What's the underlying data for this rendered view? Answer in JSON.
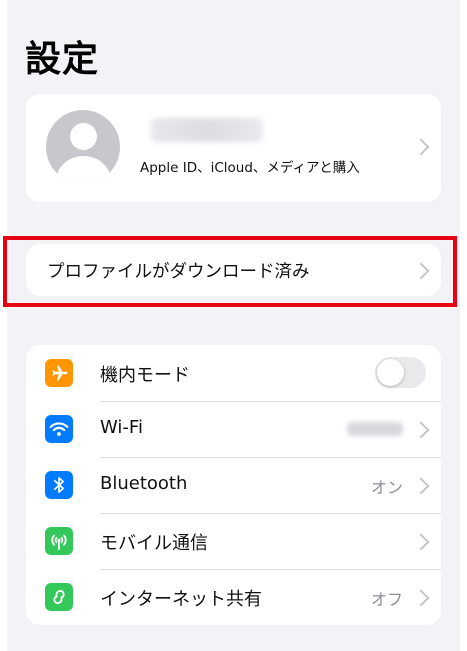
{
  "page": {
    "title": "設定"
  },
  "profile": {
    "subtitle": "Apple ID、iCloud、メディアと購入"
  },
  "downloaded_profile": {
    "label": "プロファイルがダウンロード済み"
  },
  "settings": [
    {
      "label": "機内モード",
      "icon": "airplane-icon",
      "color": "#ff9500"
    },
    {
      "label": "Wi-Fi",
      "icon": "wifi-icon",
      "color": "#007aff"
    },
    {
      "label": "Bluetooth",
      "value": "オン",
      "icon": "bluetooth-icon",
      "color": "#007aff"
    },
    {
      "label": "モバイル通信",
      "icon": "antenna-icon",
      "color": "#34c759"
    },
    {
      "label": "インターネット共有",
      "value": "オフ",
      "icon": "personal-hotspot-icon",
      "color": "#34c759"
    }
  ],
  "colors": {
    "highlight": "#e50012",
    "background": "#f2f2f7"
  }
}
